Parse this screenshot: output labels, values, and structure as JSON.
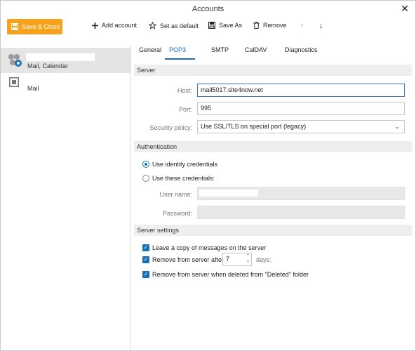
{
  "window": {
    "title": "Accounts",
    "close_glyph": "✕"
  },
  "toolbar": {
    "save_close": "Save & Close",
    "add_account": "Add account",
    "set_default": "Set as default",
    "save_as": "Save As",
    "remove": "Remove",
    "move_up": "↑",
    "move_down": "↓"
  },
  "sidebar": {
    "accounts": [
      {
        "sub": "Mail, Calendar",
        "icon": "account-sync-icon"
      },
      {
        "sub": "Mail",
        "icon": "account-mail-icon"
      }
    ]
  },
  "tabs": [
    "General",
    "POP3",
    "SMTP",
    "CalDAV",
    "Diagnostics"
  ],
  "active_tab": "POP3",
  "server": {
    "header": "Server",
    "host_label": "Host:",
    "host_value": "mail5017.site4now.net",
    "port_label": "Port:",
    "port_value": "995",
    "security_label": "Security policy:",
    "security_value": "Use SSL/TLS on special port (legacy)"
  },
  "auth": {
    "header": "Authentication",
    "identity": "Use identity credentials",
    "these": "Use these credentials:",
    "username_label": "User name:",
    "password_label": "Password:"
  },
  "settings": {
    "header": "Server settings",
    "leave_copy": "Leave a copy of messages on the server",
    "remove_after": "Remove from server after",
    "days_value": "7",
    "days_label": "days:",
    "remove_deleted": "Remove from server when deleted from \"Deleted\" folder"
  },
  "colors": {
    "accent": "#f7a21b",
    "link": "#1a6fb5"
  }
}
